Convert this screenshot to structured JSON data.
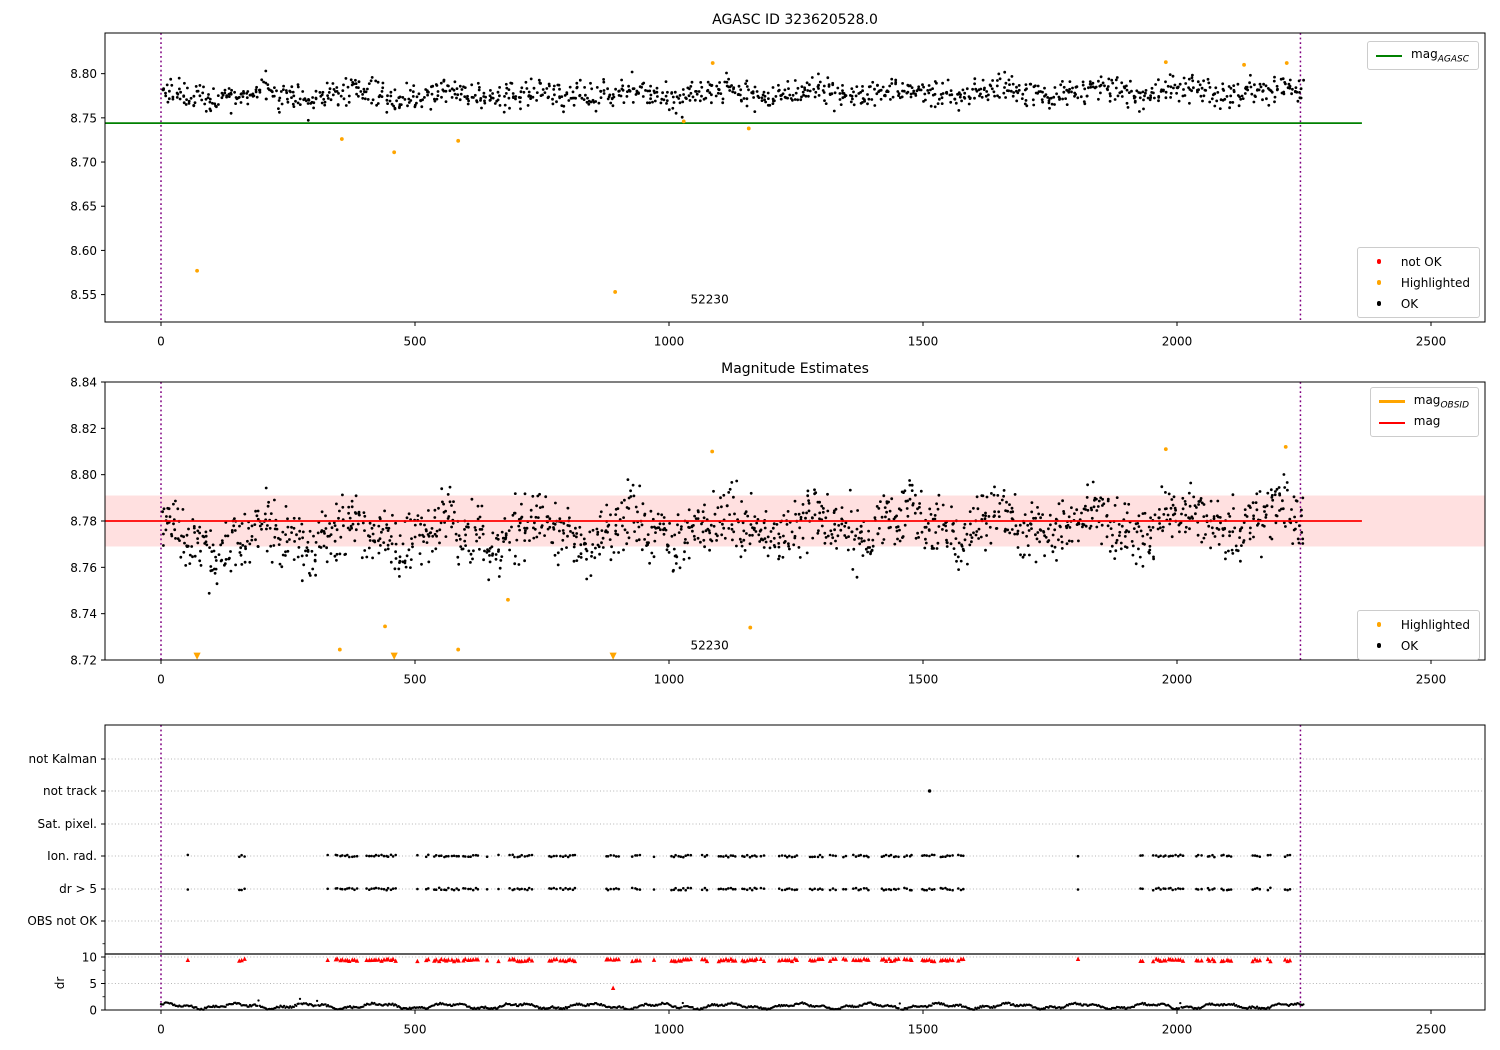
{
  "figure": {
    "background": "#ffffff"
  },
  "chart_data": [
    {
      "id": "agasc_mag",
      "type": "scatter",
      "title": "AGASC ID 323620528.0",
      "xlim": [
        -110,
        2606
      ],
      "ylim": [
        8.519,
        8.846
      ],
      "xticks": [
        0,
        500,
        1000,
        1500,
        2000,
        2500
      ],
      "yticks": [
        8.55,
        8.6,
        8.65,
        8.7,
        8.75,
        8.8
      ],
      "ytick_labels": [
        "8.55",
        "8.60",
        "8.65",
        "8.70",
        "8.75",
        "8.80"
      ],
      "mag_line": {
        "y": 8.744,
        "x_end": 2364,
        "color": "#008000",
        "label_text": "mag",
        "label_sub": "AGASC"
      },
      "obs_window": {
        "vlines": [
          0,
          2243
        ],
        "color": "#800080"
      },
      "annotation": {
        "text": "52230",
        "x": 1080,
        "y": 8.545
      },
      "legend_lines": [
        {
          "label_text": "mag",
          "label_sub": "AGASC",
          "color": "#008000"
        }
      ],
      "legend_markers": [
        {
          "label": "not OK",
          "color": "#ff0000"
        },
        {
          "label": "Highlighted",
          "color": "#ffa500"
        },
        {
          "label": "OK",
          "color": "#000000"
        }
      ],
      "ok_points": {
        "color": "#000000",
        "n": 1150,
        "x_min": 3,
        "x_max": 2250,
        "y_center": 8.7775,
        "trend": 0.006,
        "wave": 0.0045,
        "noise": 0.0075,
        "seed": 42
      },
      "highlighted_points": {
        "color": "#ffa500",
        "points": [
          [
            71,
            8.577
          ],
          [
            356,
            8.726
          ],
          [
            459,
            8.711
          ],
          [
            585,
            8.724
          ],
          [
            894,
            8.553
          ],
          [
            1029,
            8.746
          ],
          [
            1086,
            8.812
          ],
          [
            1157,
            8.738
          ],
          [
            1978,
            8.813
          ],
          [
            2132,
            8.81
          ],
          [
            2216,
            8.812
          ]
        ]
      }
    },
    {
      "id": "mag_estimates",
      "type": "scatter",
      "title": "Magnitude Estimates",
      "xlim": [
        -110,
        2606
      ],
      "ylim": [
        8.72,
        8.84
      ],
      "xticks": [
        0,
        500,
        1000,
        1500,
        2000,
        2500
      ],
      "yticks": [
        8.72,
        8.74,
        8.76,
        8.78,
        8.8,
        8.82,
        8.84
      ],
      "ytick_labels": [
        "8.72",
        "8.74",
        "8.76",
        "8.78",
        "8.80",
        "8.82",
        "8.84"
      ],
      "mag_line": {
        "y": 8.78,
        "x_end": 2364,
        "color": "#ff0000",
        "label_text": "mag",
        "label_sub": ""
      },
      "band": {
        "lo": 8.769,
        "hi": 8.791,
        "color": "rgba(255,0,0,0.12)"
      },
      "obs_window": {
        "vlines": [
          0,
          2243
        ],
        "color": "#800080"
      },
      "annotation": {
        "text": "52230",
        "x": 1080,
        "y": 8.7265
      },
      "legend_lines": [
        {
          "label_text": "mag",
          "label_sub": "OBSID",
          "color": "#ffa500"
        },
        {
          "label_text": "mag",
          "label_sub": "",
          "color": "#ff0000"
        }
      ],
      "legend_markers": [
        {
          "label": "Highlighted",
          "color": "#ffa500"
        },
        {
          "label": "OK",
          "color": "#000000"
        }
      ],
      "ok_points": {
        "color": "#000000",
        "n": 1500,
        "x_min": 3,
        "x_max": 2250,
        "y_center": 8.7765,
        "trend": 0.009,
        "wave": 0.005,
        "noise": 0.0065,
        "seed": 11
      },
      "highlighted_points": {
        "color": "#ffa500",
        "points": [
          [
            352,
            8.7245
          ],
          [
            441,
            8.7345
          ],
          [
            585,
            8.7245
          ],
          [
            683,
            8.746
          ],
          [
            1085,
            8.81
          ],
          [
            1160,
            8.734
          ],
          [
            1978,
            8.811
          ],
          [
            2214,
            8.812
          ]
        ]
      },
      "clipped_low": {
        "color": "#ffa500",
        "x": [
          71,
          459,
          890
        ],
        "y": 8.72
      }
    },
    {
      "id": "quality_flags",
      "type": "scatter",
      "categories": [
        "not Kalman",
        "not track",
        "Sat. pixel.",
        "Ion. rad.",
        "dr > 5",
        "OBS not OK"
      ],
      "dr_axis": {
        "label": "dr",
        "ticks": [
          10,
          5,
          0
        ],
        "tick_labels": [
          "10",
          "5",
          "0"
        ],
        "minor_ticks": [
          12.5,
          7.5,
          2.5
        ],
        "threshold": 10
      },
      "xticks": [
        0,
        500,
        1000,
        1500,
        2000,
        2500
      ],
      "obs_window": {
        "vlines": [
          0,
          2243
        ],
        "color": "#800080"
      },
      "flag_rows": [
        "Ion. rad.",
        "dr > 5"
      ],
      "flag_color": "#000000",
      "flag_clusters": [
        [
          53,
          57
        ],
        [
          155,
          165
        ],
        [
          329,
          332
        ],
        [
          343,
          388
        ],
        [
          405,
          467
        ],
        [
          504,
          508
        ],
        [
          522,
          530
        ],
        [
          538,
          590
        ],
        [
          595,
          625
        ],
        [
          642,
          646
        ],
        [
          665,
          669
        ],
        [
          687,
          733
        ],
        [
          764,
          782
        ],
        [
          786,
          816
        ],
        [
          876,
          904
        ],
        [
          928,
          944
        ],
        [
          970,
          974
        ],
        [
          1004,
          1046
        ],
        [
          1066,
          1076
        ],
        [
          1098,
          1132
        ],
        [
          1144,
          1176
        ],
        [
          1182,
          1188
        ],
        [
          1218,
          1252
        ],
        [
          1278,
          1306
        ],
        [
          1318,
          1328
        ],
        [
          1344,
          1352
        ],
        [
          1364,
          1396
        ],
        [
          1418,
          1452
        ],
        [
          1464,
          1482
        ],
        [
          1498,
          1522
        ],
        [
          1534,
          1562
        ],
        [
          1570,
          1582
        ],
        [
          1806,
          1810
        ],
        [
          1928,
          1936
        ],
        [
          1954,
          2012
        ],
        [
          2038,
          2050
        ],
        [
          2060,
          2076
        ],
        [
          2088,
          2112
        ],
        [
          2148,
          2164
        ],
        [
          2178,
          2186
        ],
        [
          2212,
          2222
        ]
      ],
      "not_track_points": [
        1513
      ],
      "red_points": {
        "color": "#ff0000",
        "dr_level": 9.7,
        "outliers": [
          [
            890,
            4.2
          ]
        ]
      },
      "dr_trace": {
        "color": "#000000",
        "x_min": 0,
        "x_max": 2250,
        "step": 2.4,
        "base": 0.55,
        "seed": 5
      },
      "grid_color": "#b5b5b5"
    }
  ]
}
